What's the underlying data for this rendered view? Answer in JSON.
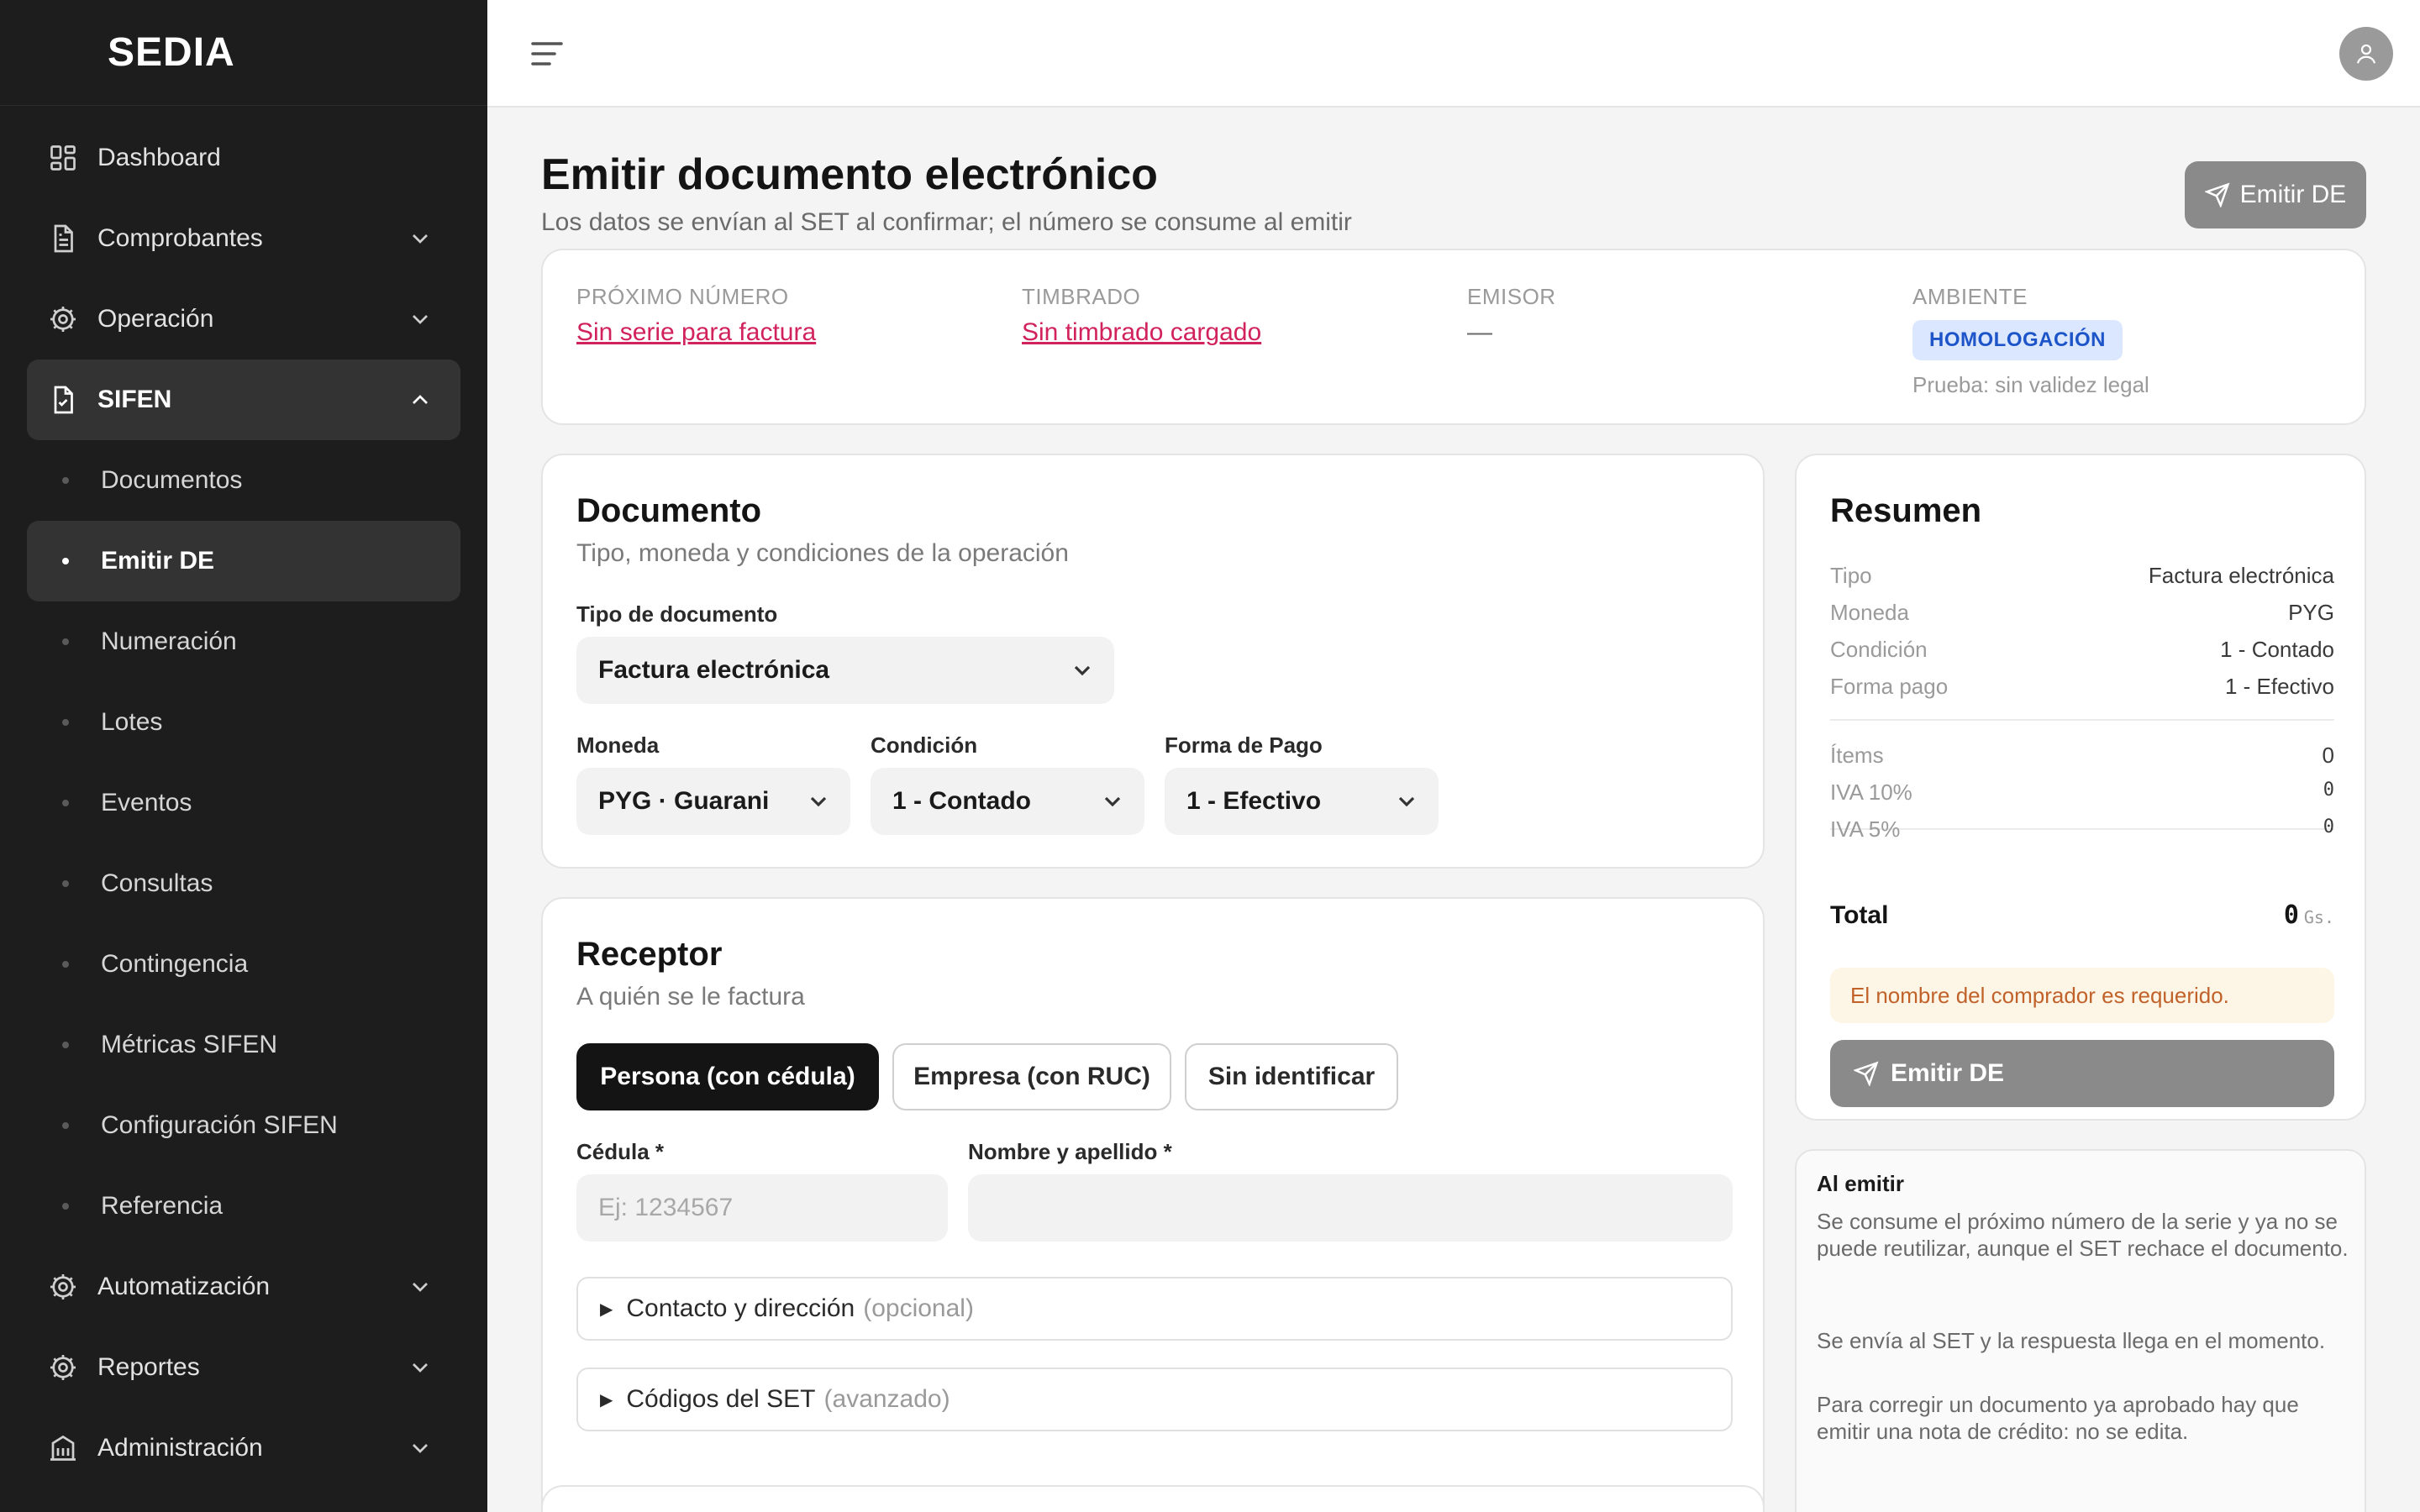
{
  "app": {
    "brand": "SEDIA"
  },
  "sidebar": {
    "items": [
      {
        "label": "Dashboard",
        "icon": "dashboard-grid-icon"
      },
      {
        "label": "Comprobantes",
        "icon": "document-icon"
      },
      {
        "label": "Operación",
        "icon": "gear-icon"
      },
      {
        "label": "SIFEN",
        "icon": "document-check-icon"
      }
    ],
    "sifen_subitems": [
      {
        "label": "Documentos"
      },
      {
        "label": "Emitir DE"
      },
      {
        "label": "Numeración"
      },
      {
        "label": "Lotes"
      },
      {
        "label": "Eventos"
      },
      {
        "label": "Consultas"
      },
      {
        "label": "Contingencia"
      },
      {
        "label": "Métricas SIFEN"
      },
      {
        "label": "Configuración SIFEN"
      },
      {
        "label": "Referencia"
      }
    ],
    "bottom_items": [
      {
        "label": "Automatización",
        "icon": "gear-icon"
      },
      {
        "label": "Reportes",
        "icon": "gear-icon"
      },
      {
        "label": "Administración",
        "icon": "building-icon"
      }
    ]
  },
  "page": {
    "title": "Emitir documento electrónico",
    "subtitle": "Los datos se envían al SET al confirmar; el número se consume al emitir",
    "emit_button": "Emitir DE"
  },
  "info": {
    "next_number_label": "PRÓXIMO NÚMERO",
    "next_number_value": "Sin serie para factura",
    "stamp_label": "TIMBRADO",
    "stamp_value": "Sin timbrado cargado",
    "issuer_label": "EMISOR",
    "issuer_value": "—",
    "env_label": "AMBIENTE",
    "env_badge": "HOMOLOGACIÓN",
    "env_note": "Prueba: sin validez legal"
  },
  "document": {
    "title": "Documento",
    "subtitle": "Tipo, moneda y condiciones de la operación",
    "type_label": "Tipo de documento",
    "type_value": "Factura electrónica",
    "currency_label": "Moneda",
    "currency_value": "PYG · Guarani",
    "condition_label": "Condición",
    "condition_value": "1 - Contado",
    "payment_label": "Forma de Pago",
    "payment_value": "1 - Efectivo"
  },
  "receiver": {
    "title": "Receptor",
    "subtitle": "A quién se le factura",
    "segments": [
      "Persona (con cédula)",
      "Empresa (con RUC)",
      "Sin identificar"
    ],
    "id_label": "Cédula *",
    "id_placeholder": "Ej: 1234567",
    "name_label": "Nombre y apellido *",
    "name_placeholder": "",
    "contact_summary": "Contacto y dirección",
    "contact_hint": "(opcional)",
    "codes_summary": "Códigos del SET",
    "codes_hint": "(avanzado)"
  },
  "summary": {
    "title": "Resumen",
    "rows": [
      {
        "k": "Tipo",
        "v": "Factura electrónica"
      },
      {
        "k": "Moneda",
        "v": "PYG"
      },
      {
        "k": "Condición",
        "v": "1 - Contado"
      },
      {
        "k": "Forma pago",
        "v": "1 - Efectivo"
      }
    ],
    "items_label": "Ítems",
    "items_value": "0",
    "iva10_label": "IVA 10%",
    "iva10_value": "0",
    "iva5_label": "IVA 5%",
    "iva5_value": "0",
    "total_label": "Total",
    "total_value": "0",
    "total_currency": "Gs.",
    "warning": "El nombre del comprador es requerido.",
    "emit_button": "Emitir DE"
  },
  "help": {
    "title": "Al emitir",
    "p1": "Se consume el próximo número de la serie y ya no se puede reutilizar, aunque el SET rechace el documento.",
    "p2": "Se envía al SET y la respuesta llega en el momento.",
    "p3": "Para corregir un documento ya aprobado hay que emitir una nota de crédito: no se edita."
  },
  "colors": {
    "sidebar_bg": "#1d1d1d",
    "link_error": "#d1225c",
    "badge_bg": "#dbe7ff",
    "badge_text": "#1d55c9",
    "button_disabled": "#8a8a8a",
    "warning_text": "#c0622a"
  }
}
